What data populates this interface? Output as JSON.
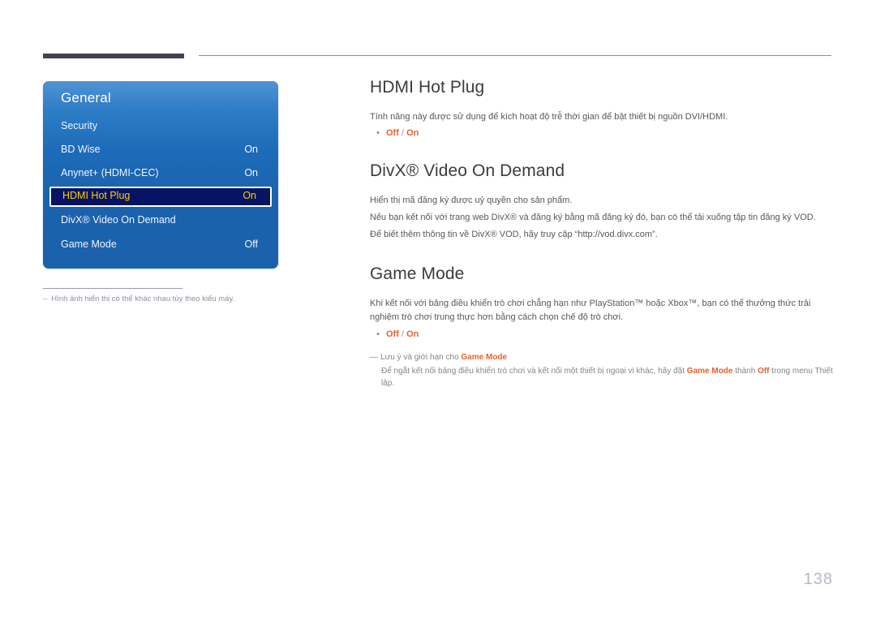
{
  "header": {
    "rule_thick": "",
    "rule_thin": ""
  },
  "osd_menu": {
    "title": "General",
    "rows": [
      {
        "label": "Security",
        "value": "",
        "selected": false
      },
      {
        "label": "BD Wise",
        "value": "On",
        "selected": false
      },
      {
        "label": "Anynet+ (HDMI-CEC)",
        "value": "On",
        "selected": false
      },
      {
        "label": "HDMI Hot Plug",
        "value": "On",
        "selected": true
      },
      {
        "label": "DivX® Video On Demand",
        "value": "",
        "selected": false
      },
      {
        "label": "Game Mode",
        "value": "Off",
        "selected": false
      }
    ],
    "colors": {
      "panel_top": "#4f93d4",
      "panel_bottom": "#1b60ab",
      "selected_background": "#071463",
      "selected_text": "#ffcc00",
      "row_text": "#eef4fb"
    }
  },
  "footnote": {
    "dash": "–",
    "text": "Hình ảnh hiển thị có thể khác nhau tùy theo kiểu máy."
  },
  "sections": {
    "hdmi_hot_plug": {
      "heading": "HDMI Hot Plug",
      "body": "Tính năng này được sử dụng để kích hoạt độ trễ thời gian để bật thiết bị nguồn DVI/HDMI.",
      "bullet_dot": "•",
      "option_off": "Off",
      "option_separator": "/",
      "option_on": "On"
    },
    "divx_vod": {
      "heading": "DivX® Video On Demand",
      "body_line_1": "Hiển thị mã đăng ký được uỷ quyền cho sản phẩm.",
      "body_line_2": "Nếu bạn kết nối với trang web DivX® và đăng ký bằng mã đăng ký đó, bạn có thể tải xuống tập tin đăng ký VOD.",
      "body_line_3": "Để biết thêm thông tin về DivX® VOD, hãy truy cập “http://vod.divx.com”."
    },
    "game_mode": {
      "heading": "Game Mode",
      "body_line_1": "Khi kết nối với bảng điều khiển trò chơi chẳng hạn như PlayStation™ hoặc Xbox™, bạn có thể thưởng thức trải",
      "body_line_2": "nghiệm trò chơi trung thực hơn bằng cách chọn chế độ trò chơi.",
      "bullet_dot": "•",
      "option_off": "Off",
      "option_separator": "/",
      "option_on": "On"
    }
  },
  "note": {
    "em_dash": "—",
    "title_prefix": "Lưu ý và giới hạn cho ",
    "title_strong": "Game Mode",
    "body_part_1": "Để ngắt kết nối bảng điều khiển trò chơi và kết nối một thiết bị ngoại vi khác, hãy đặt ",
    "body_strong_1": "Game Mode",
    "body_part_2": " thành ",
    "body_strong_2": "Off",
    "body_part_3": " trong menu Thiết lập."
  },
  "page_number": "138",
  "theme": {
    "accent_orange": "#e8622a",
    "body_gray": "#58585c",
    "heading_gray": "#3c3c3c",
    "page_number_color": "#b7b7c8"
  }
}
